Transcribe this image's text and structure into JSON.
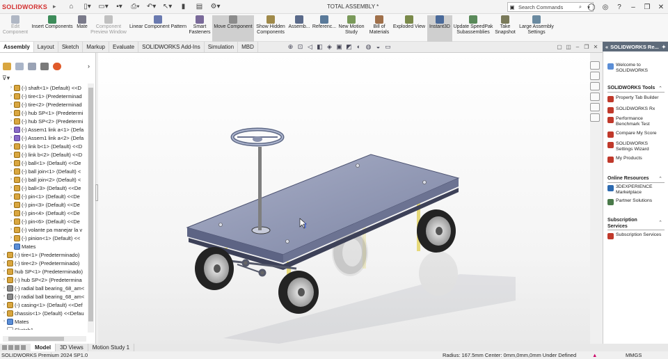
{
  "app": {
    "logo": "SOLIDWORKS",
    "document_title": "TOTAL ASSEMBLY *",
    "search_placeholder": "Search Commands"
  },
  "ribbon": [
    {
      "label": "Edit\nComponent",
      "icon": "edit-component-icon",
      "disabled": true
    },
    {
      "label": "Insert Components",
      "icon": "insert-components-icon"
    },
    {
      "label": "Mate",
      "icon": "mate-icon"
    },
    {
      "label": "Component\nPreview Window",
      "icon": "preview-window-icon",
      "disabled": true
    },
    {
      "label": "Linear Component Pattern",
      "icon": "linear-pattern-icon"
    },
    {
      "label": "Smart\nFasteners",
      "icon": "smart-fasteners-icon"
    },
    {
      "label": "Move Component",
      "icon": "move-component-icon",
      "selected": true
    },
    {
      "label": "Show Hidden\nComponents",
      "icon": "show-hidden-icon"
    },
    {
      "label": "Assemb...",
      "icon": "assembly-features-icon"
    },
    {
      "label": "Referenc...",
      "icon": "reference-geometry-icon"
    },
    {
      "label": "New Motion\nStudy",
      "icon": "motion-study-icon"
    },
    {
      "label": "Bill of\nMaterials",
      "icon": "bom-icon"
    },
    {
      "label": "Exploded View",
      "icon": "exploded-view-icon"
    },
    {
      "label": "Instant3D",
      "icon": "instant3d-icon",
      "selected": true
    },
    {
      "label": "Update SpeedPak\nSubassemblies",
      "icon": "speedpak-icon"
    },
    {
      "label": "Take\nSnapshot",
      "icon": "snapshot-icon"
    },
    {
      "label": "Large Assembly\nSettings",
      "icon": "large-assembly-icon"
    }
  ],
  "tabs": [
    "Assembly",
    "Layout",
    "Sketch",
    "Markup",
    "Evaluate",
    "SOLIDWORKS Add-Ins",
    "Simulation",
    "MBD"
  ],
  "active_tab": "Assembly",
  "tree": [
    {
      "label": "(-) shaft<1> (Default) <<D",
      "icon": "part"
    },
    {
      "label": "(-) tire<1> (Predeterminad",
      "icon": "part"
    },
    {
      "label": "(-) tire<2> (Predeterminad",
      "icon": "part"
    },
    {
      "label": "(-) hub SP<1> (Predetermi",
      "icon": "part"
    },
    {
      "label": "(-) hub SP<2> (Predetermi",
      "icon": "part"
    },
    {
      "label": "(-) Assem1 link a<1> (Defa",
      "icon": "assembly"
    },
    {
      "label": "(-) Assem1 link a<2> (Defa",
      "icon": "assembly"
    },
    {
      "label": "(-) link b<1> (Default) <<D",
      "icon": "part"
    },
    {
      "label": "(-) link b<2> (Default) <<D",
      "icon": "part"
    },
    {
      "label": "(-) ball<1> (Default) <<De",
      "icon": "part"
    },
    {
      "label": "(-) ball join<1> (Default) <",
      "icon": "part"
    },
    {
      "label": "(-) ball join<2> (Default) <",
      "icon": "part"
    },
    {
      "label": "(-) ball<3> (Default) <<De",
      "icon": "part"
    },
    {
      "label": "(-) pin<1> (Default) <<De",
      "icon": "part"
    },
    {
      "label": "(-) pin<3> (Default) <<De",
      "icon": "part"
    },
    {
      "label": "(-) pin<4> (Default) <<De",
      "icon": "part"
    },
    {
      "label": "(-) pin<6> (Default) <<De",
      "icon": "part"
    },
    {
      "label": "(-) volante pa manejar la v",
      "icon": "part"
    },
    {
      "label": "(-) pinion<1> (Default) <<",
      "icon": "part"
    },
    {
      "label": "Mates",
      "icon": "mates"
    },
    {
      "label": "(-) tire<1> (Predeterminado)",
      "icon": "part"
    },
    {
      "label": "(-) tire<2> (Predeterminado)",
      "icon": "part"
    },
    {
      "label": "hub SP<1> (Predeterminado)",
      "icon": "part"
    },
    {
      "label": "(-) hub SP<2> (Predetermina",
      "icon": "part"
    },
    {
      "label": "(-) radial ball bearing_68_am<",
      "icon": "toolbox"
    },
    {
      "label": "(-) radial ball bearing_68_am<",
      "icon": "toolbox"
    },
    {
      "label": "(-) casing<1> (Default) <<Def",
      "icon": "part"
    },
    {
      "label": "chassis<1> (Default) <<Defau",
      "icon": "part"
    },
    {
      "label": "Mates",
      "icon": "mates"
    },
    {
      "label": "Sketch1",
      "icon": "sketch"
    }
  ],
  "task_pane": {
    "title": "SOLIDWORKS Re...",
    "welcome": "Welcome to\nSOLIDWORKS",
    "tools_header": "SOLIDWORKS Tools",
    "tools": [
      "Property Tab Builder",
      "SOLIDWORKS Rx",
      "Performance\nBenchmark Test",
      "Compare My Score",
      "SOLIDWORKS\nSettings Wizard",
      "My Products"
    ],
    "online_header": "Online Resources",
    "online": [
      "3DEXPERIENCE\nMarketplace",
      "Partner Solutions"
    ],
    "sub_header": "Subscription\nServices",
    "sub": [
      "Subscription Services"
    ]
  },
  "bottom_tabs": [
    "Model",
    "3D Views",
    "Motion Study 1"
  ],
  "active_bottom_tab": "Model",
  "status": {
    "left": "SOLIDWORKS Premium 2024 SP1.0",
    "right": "Radius: 167.5mm  Center: 0mm,0mm,0mm   Under Defined",
    "units": "MMGS"
  },
  "colors": {
    "accent_red": "#d32f2f",
    "chassis_plate": "#8f97b5",
    "tire": "#2b2b2b",
    "task_pane_header": "#5e6b7a"
  }
}
